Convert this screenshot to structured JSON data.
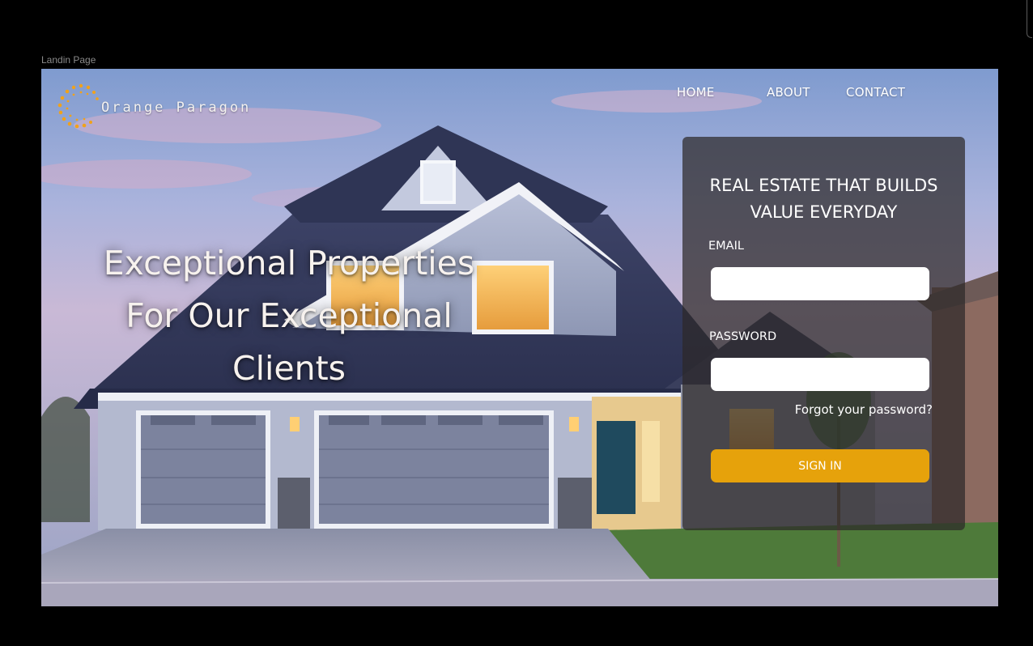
{
  "frame": {
    "label": "Landin Page"
  },
  "brand": {
    "name": "Orange Paragon",
    "accent_color": "#e6a20b",
    "logo_icon": "orange-dot-ring-icon"
  },
  "nav": {
    "items": [
      {
        "label": "HOME"
      },
      {
        "label": "ABOUT"
      },
      {
        "label": "CONTACT"
      }
    ]
  },
  "hero": {
    "lines": [
      "Exceptional Properties",
      "For Our Exceptional",
      "Clients"
    ]
  },
  "login": {
    "title_lines": [
      "REAL ESTATE THAT BUILDS",
      "VALUE EVERYDAY"
    ],
    "email_label": "EMAIL",
    "email_value": "",
    "password_label": "PASSWORD",
    "password_value": "",
    "forgot_label": "Forgot your password?",
    "signin_label": "SIGN IN",
    "signin_color": "#e6a20b"
  },
  "background": {
    "image": "suburban-house-at-dusk"
  }
}
